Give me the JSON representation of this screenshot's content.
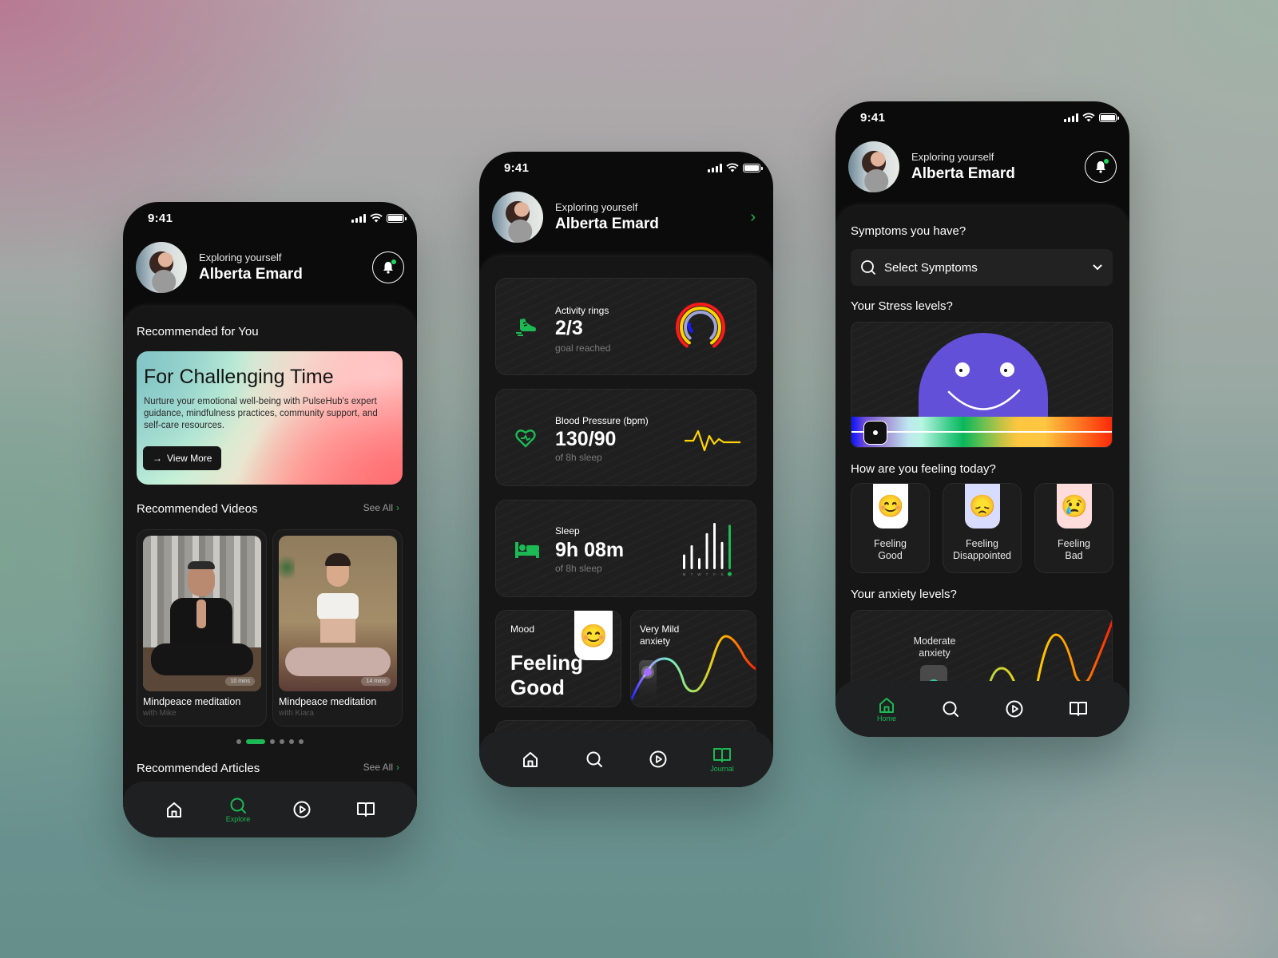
{
  "status_bar": {
    "time": "9:41"
  },
  "profile": {
    "subtitle": "Exploring yourself",
    "name": "Alberta Emard"
  },
  "explore_screen": {
    "recommended_title": "Recommended for You",
    "promo": {
      "title": "For Challenging Time",
      "body": "Nurture your emotional well-being with PulseHub's expert guidance, mindfulness practices, community support, and self-care resources.",
      "button": "View More"
    },
    "videos_title": "Recommended Videos",
    "see_all": "See All",
    "videos": [
      {
        "title": "Mindpeace meditation",
        "with": "with Mike",
        "duration": "10 mins"
      },
      {
        "title": "Mindpeace meditation",
        "with": "with Kiara",
        "duration": "14 mins"
      }
    ],
    "carousel": {
      "count": 6,
      "active": 2
    },
    "articles_title": "Recommended Articles",
    "nav": {
      "active": "Explore",
      "active_label": "Explore"
    }
  },
  "journal_screen": {
    "activity": {
      "label": "Activity rings",
      "value": "2/3",
      "sub": "goal reached",
      "rings": [
        {
          "color": "#ff1a1a",
          "progress": 0.8
        },
        {
          "color": "#ffd400",
          "progress": 0.8
        },
        {
          "color": "#9fa3d8",
          "progress": 0.75
        }
      ]
    },
    "blood_pressure": {
      "label": "Blood Pressure (bpm)",
      "value": "130/90",
      "sub": "of 8h sleep"
    },
    "sleep": {
      "label": "Sleep",
      "value": "9h 08m",
      "sub": "of 8h sleep",
      "days": [
        "M",
        "T",
        "W",
        "T",
        "F",
        "S",
        "S"
      ],
      "hours": [
        3.2,
        5.2,
        2.4,
        7.8,
        10,
        5.9,
        9.6
      ]
    },
    "mood": {
      "label": "Mood",
      "value_line1": "Feeling",
      "value_line2": "Good",
      "emoji": "😊"
    },
    "anxiety": {
      "label_line1": "Very Mild",
      "label_line2": "anxiety"
    },
    "nav": {
      "active": "Journal",
      "active_label": "Journal"
    }
  },
  "home_screen": {
    "symptoms_title": "Symptoms you have?",
    "symptoms_placeholder": "Select Symptoms",
    "stress_title": "Your Stress levels?",
    "stress_level": 0.05,
    "feeling_title": "How are you feeling today?",
    "feelings": [
      {
        "line1": "Feeling",
        "line2": "Good",
        "emoji": "😊",
        "bg": "#ffffff"
      },
      {
        "line1": "Feeling",
        "line2": "Disappointed",
        "emoji": "😞",
        "bg": "#d8ddff"
      },
      {
        "line1": "Feeling",
        "line2": "Bad",
        "emoji": "😢",
        "bg": "#ffdcdc"
      }
    ],
    "anxiety_title": "Your anxiety levels?",
    "anxiety_label_line1": "Moderate",
    "anxiety_label_line2": "anxiety",
    "nav": {
      "active": "Home",
      "active_label": "Home"
    }
  },
  "colors": {
    "accent": "#1db954",
    "stress_face": "#6350d8"
  }
}
